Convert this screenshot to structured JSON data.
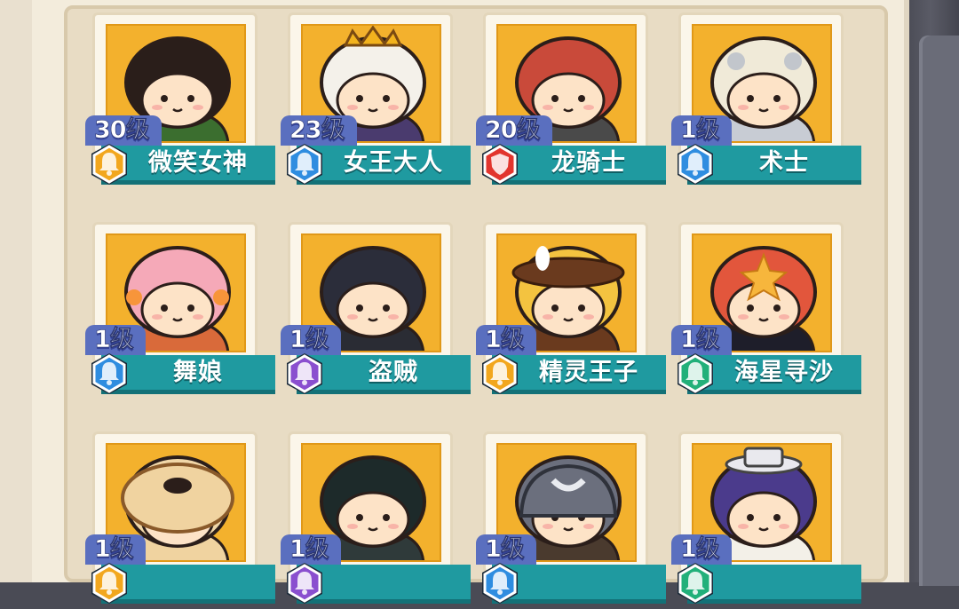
{
  "colors": {
    "portrait_bg": "#f3b12d",
    "name_bar": "#1f9aa0",
    "level_tag": "#5a6fbf",
    "rarity_gold": "#f2a71e",
    "rarity_blue": "#2f8de0",
    "rarity_red": "#e2352e",
    "rarity_purple": "#8a4fcf",
    "rarity_green": "#22b07a"
  },
  "characters": [
    {
      "level": "30级",
      "name": "微笑女神",
      "rarity": "gold",
      "rarity_icon": "bell-icon",
      "portrait": "smiling-goddess-portrait"
    },
    {
      "level": "23级",
      "name": "女王大人",
      "rarity": "blue",
      "rarity_icon": "bell-icon",
      "portrait": "queen-portrait"
    },
    {
      "level": "20级",
      "name": "龙骑士",
      "rarity": "red",
      "rarity_icon": "shield-icon",
      "portrait": "dragon-knight-portrait"
    },
    {
      "level": "1级",
      "name": "术士",
      "rarity": "blue",
      "rarity_icon": "bell-icon",
      "portrait": "warlock-portrait"
    },
    {
      "level": "1级",
      "name": "舞娘",
      "rarity": "blue",
      "rarity_icon": "bell-icon",
      "portrait": "dancer-portrait"
    },
    {
      "level": "1级",
      "name": "盗贼",
      "rarity": "purple",
      "rarity_icon": "bell-icon",
      "portrait": "thief-portrait"
    },
    {
      "level": "1级",
      "name": "精灵王子",
      "rarity": "gold",
      "rarity_icon": "bell-icon",
      "portrait": "elf-prince-portrait"
    },
    {
      "level": "1级",
      "name": "海星寻沙",
      "rarity": "green",
      "rarity_icon": "bell-icon",
      "portrait": "starfish-seeker-portrait"
    },
    {
      "level": "1级",
      "name": "",
      "rarity": "gold",
      "rarity_icon": "bell-icon",
      "portrait": "chef-portrait"
    },
    {
      "level": "1级",
      "name": "",
      "rarity": "purple",
      "rarity_icon": "bell-icon",
      "portrait": "masked-hero-portrait"
    },
    {
      "level": "1级",
      "name": "",
      "rarity": "blue",
      "rarity_icon": "bell-icon",
      "portrait": "samurai-portrait"
    },
    {
      "level": "1级",
      "name": "",
      "rarity": "green",
      "rarity_icon": "bell-icon",
      "portrait": "gentleman-portrait"
    }
  ]
}
